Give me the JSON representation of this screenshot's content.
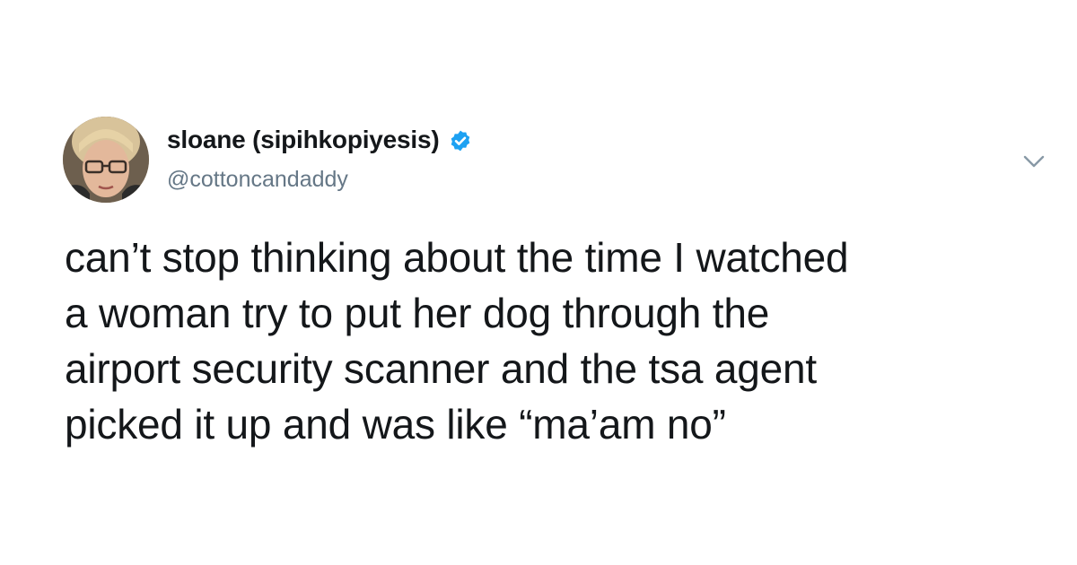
{
  "tweet": {
    "display_name": "sloane (sipihkopiyesis)",
    "handle": "@cottoncandaddy",
    "verified": true,
    "text": "can’t stop thinking about the time I watched\na woman try to put her dog through the\nairport security scanner and the tsa agent\npicked it up and was like “ma’am no”"
  },
  "icons": {
    "verified": "verified-badge-icon",
    "menu": "chevron-down-icon"
  },
  "colors": {
    "verified_blue": "#1da1f2",
    "name_text": "#14171a",
    "handle_text": "#657786",
    "caret": "#8899a6"
  }
}
